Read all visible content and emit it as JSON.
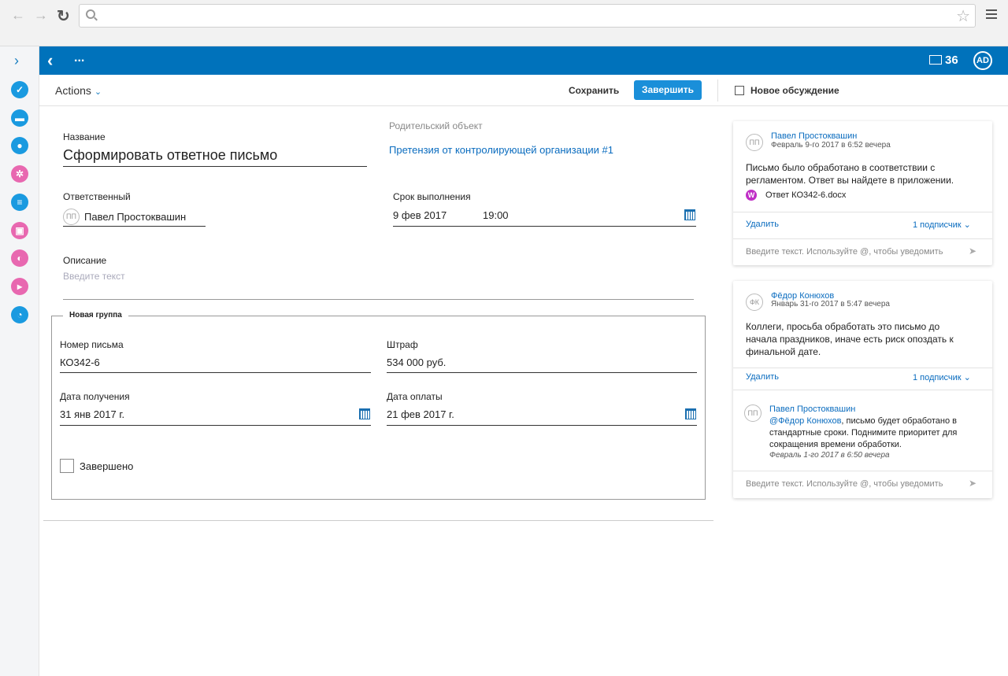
{
  "browser": {
    "url": ""
  },
  "header": {
    "dots": "...",
    "mail_count": "36",
    "avatar_initials": "AD"
  },
  "toolbar": {
    "actions_label": "Actions",
    "save_label": "Сохранить",
    "finish_label": "Завершить",
    "new_discussion_label": "Новое обсуждение"
  },
  "form": {
    "name_label": "Название",
    "name_value": "Сформировать ответное письмо",
    "parent_label": "Родительский объект",
    "parent_value": "Претензия от контролирующей организации #1",
    "responsible_label": "Ответственный",
    "responsible_initials": "ПП",
    "responsible_value": "Павел Простоквашин",
    "deadline_label": "Срок выполнения",
    "deadline_date": "9 фев 2017",
    "deadline_time": "19:00",
    "description_label": "Описание",
    "description_placeholder": "Введите текст"
  },
  "group": {
    "title": "Новая группа",
    "letter_no_label": "Номер письма",
    "letter_no_value": "КО342-6",
    "fine_label": "Штраф",
    "fine_value": "534 000 руб.",
    "receipt_date_label": "Дата получения",
    "receipt_date_value": "31 янв 2017 г.",
    "payment_date_label": "Дата оплаты",
    "payment_date_value": "21 фев 2017 г.",
    "completed_label": "Завершено"
  },
  "comments": [
    {
      "initials": "ПП",
      "author": "Павел Простоквашин",
      "date": "Февраль 9-го 2017 в 6:52 вечера",
      "text_line1": "Письмо было обработано в соответствии с",
      "text_line2": "регламентом. Ответ вы найдете в приложении.",
      "attachment": "Ответ КО342-6.docx",
      "delete_label": "Удалить",
      "subscribers_label": "1 подписчик",
      "input_placeholder": "Введите текст. Используйте @, чтобы уведомить"
    },
    {
      "initials": "ФК",
      "author": "Фёдор Конюхов",
      "date": "Январь 31-го 2017 в 5:47 вечера",
      "text_line1": "Коллеги, просьба обработать это письмо до",
      "text_line2": "начала праздников, иначе есть риск опоздать к",
      "text_line3": "финальной дате.",
      "delete_label": "Удалить",
      "subscribers_label": "1 подписчик",
      "reply": {
        "initials": "ПП",
        "author": "Павел Простоквашин",
        "mention": "@Фёдор Конюхов",
        "text_line1": ", письмо будет обработано в",
        "text_line2": "стандартные сроки. Поднимите приоритет для",
        "text_line3": "сокращения времени обработки.",
        "date": "Февраль 1-го 2017 в 6:50 вечера"
      },
      "input_placeholder": "Введите текст. Используйте @, чтобы уведомить"
    }
  ]
}
